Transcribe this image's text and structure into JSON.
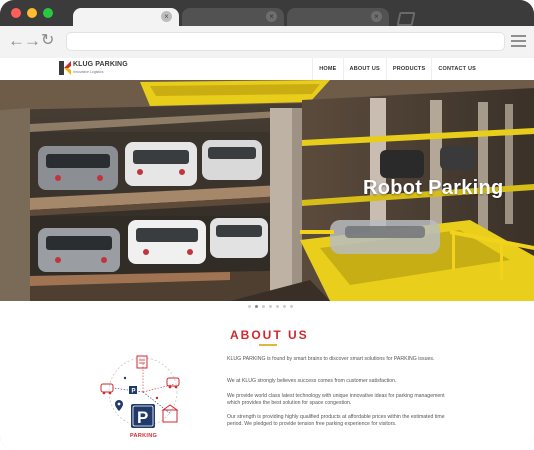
{
  "browser": {
    "tabs": [
      {
        "label": "",
        "active": true
      },
      {
        "label": "",
        "active": false
      },
      {
        "label": "",
        "active": false
      }
    ],
    "tab_close_glyph": "×",
    "nav_icons": [
      "back-arrow-icon",
      "forward-arrow-icon",
      "reload-icon"
    ],
    "back_glyph": "←",
    "forward_glyph": "→",
    "reload_glyph": "↻",
    "address_value": ""
  },
  "site": {
    "logo_text": "KLUG PARKING",
    "logo_subtext": "Innovative Logistics",
    "nav": [
      "HOME",
      "ABOUT US",
      "PRODUCTS",
      "CONTACT US"
    ],
    "hero_caption": "Robot Parking",
    "slider_count": 7,
    "slider_active_index": 1
  },
  "about": {
    "title": "ABOUT US",
    "paragraphs": [
      "KLUG PARKING is found by smart brains to discover smart solutions for PARKING issues.",
      "We at KLUG strongly believes success comes from customer satisfaction.",
      "We provide world class latest technology with unique innovative ideas for parking management which provides the best solution for space congestion.",
      "Our strength is providing highly qualified products at affordable prices within the estimated time period. We pledged to provide tension free parking experience for visitors."
    ],
    "illustration_sign": "P",
    "illustration_label": "PARKING"
  },
  "colors": {
    "accent_red": "#d1282f",
    "accent_yellow": "#e0b83a",
    "hero_yellow": "#f2d21c",
    "parking_navy": "#1f3a6b"
  }
}
